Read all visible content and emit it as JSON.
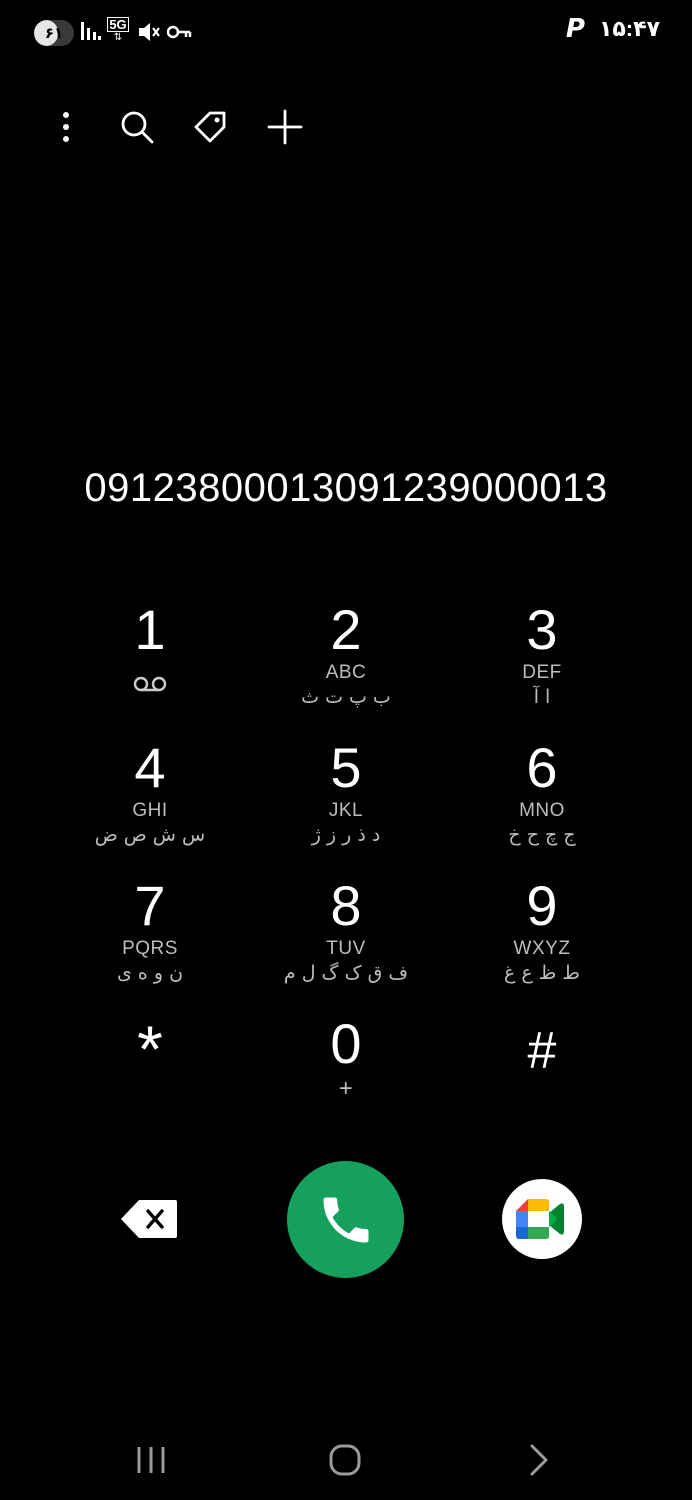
{
  "status_bar": {
    "battery_level": "۶۱",
    "battery_fraction": 0.61,
    "network_type": "5G",
    "clock": "۱۵:۴۷",
    "app_badge": "P",
    "icons": [
      "signal-icon",
      "network-5g-icon",
      "mute-icon",
      "vpn-key-icon"
    ]
  },
  "toolbar": {
    "icons": [
      "more-options-icon",
      "search-icon",
      "tag-icon",
      "add-contact-icon"
    ]
  },
  "dialer": {
    "number": "09123800013091239000013"
  },
  "keypad": {
    "keys": [
      {
        "digit": "1",
        "letters": "",
        "persian": "",
        "sub_icon": "voicemail-icon"
      },
      {
        "digit": "2",
        "letters": "ABC",
        "persian": "ب پ ت ث"
      },
      {
        "digit": "3",
        "letters": "DEF",
        "persian": "ا آ"
      },
      {
        "digit": "4",
        "letters": "GHI",
        "persian": "س ش ص ض"
      },
      {
        "digit": "5",
        "letters": "JKL",
        "persian": "د ذ ر ز ژ"
      },
      {
        "digit": "6",
        "letters": "MNO",
        "persian": "ج چ ح خ"
      },
      {
        "digit": "7",
        "letters": "PQRS",
        "persian": "ن و ه ی"
      },
      {
        "digit": "8",
        "letters": "TUV",
        "persian": "ف ق ک گ ل م"
      },
      {
        "digit": "9",
        "letters": "WXYZ",
        "persian": "ط ظ ع غ"
      },
      {
        "digit": "*",
        "letters": "",
        "persian": ""
      },
      {
        "digit": "0",
        "letters": "+",
        "persian": ""
      },
      {
        "digit": "#",
        "letters": "",
        "persian": ""
      }
    ]
  },
  "actions": {
    "icons": [
      "backspace-icon",
      "phone-icon",
      "google-meet-icon"
    ],
    "call_color": "#16a05e"
  },
  "nav_bar": {
    "icons": [
      "recent-apps-icon",
      "home-icon",
      "back-icon"
    ]
  }
}
